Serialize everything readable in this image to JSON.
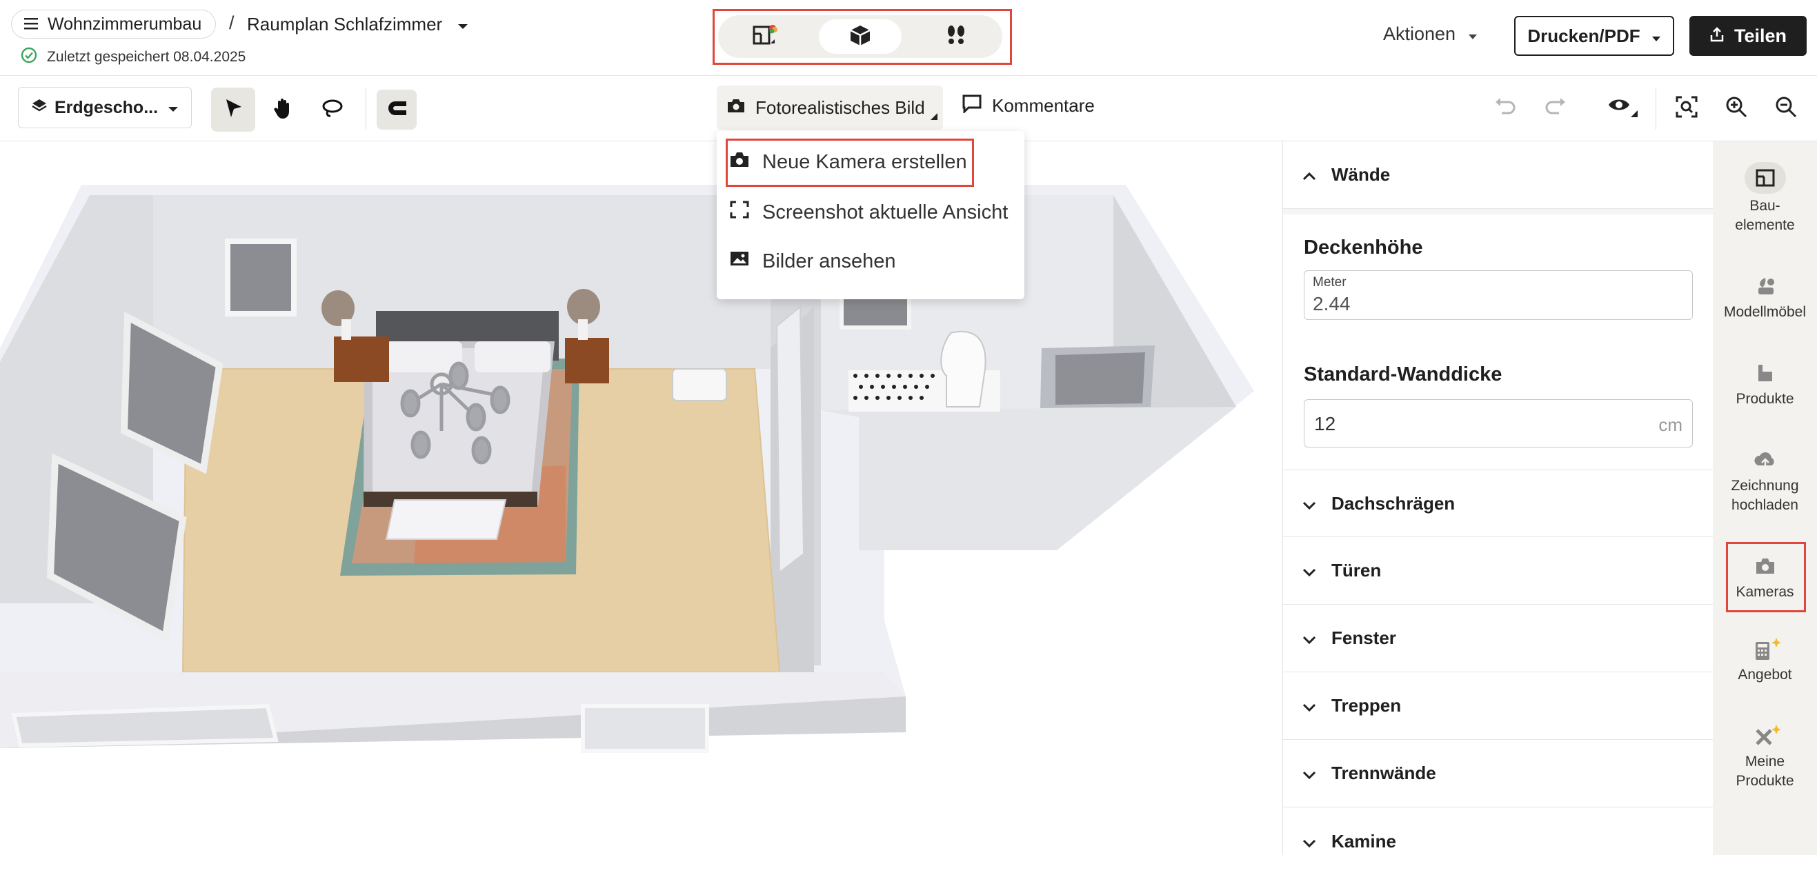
{
  "header": {
    "project_name": "Wohnzimmerumbau",
    "separator": "/",
    "page_name": "Raumplan Schlafzimmer",
    "saved_status": "Zuletzt gespeichert 08.04.2025",
    "view_modes": [
      {
        "name": "2d-plan",
        "active": false
      },
      {
        "name": "3d-view",
        "active": true
      },
      {
        "name": "walkthrough",
        "active": false
      }
    ],
    "actions_label": "Aktionen",
    "print_label": "Drucken/PDF",
    "share_label": "Teilen"
  },
  "toolbar": {
    "floor_label": "Erdgescho...",
    "photo_label": "Fotorealistisches Bild",
    "comments_label": "Kommentare"
  },
  "dropdown": {
    "items": [
      {
        "label": "Neue Kamera erstellen",
        "icon": "camera-icon"
      },
      {
        "label": "Screenshot aktuelle Ansicht",
        "icon": "screenshot-frame-icon"
      },
      {
        "label": "Bilder ansehen",
        "icon": "image-icon"
      }
    ]
  },
  "panel": {
    "walls_section": "Wände",
    "ceiling_label": "Deckenhöhe",
    "ceiling_unit_label": "Meter",
    "ceiling_value": "2.44",
    "wall_thickness_label": "Standard-Wanddicke",
    "wall_thickness_value": "12",
    "wall_thickness_unit": "cm",
    "sections": [
      "Dachschrägen",
      "Türen",
      "Fenster",
      "Treppen",
      "Trennwände",
      "Kamine"
    ]
  },
  "sidebar": {
    "items": [
      {
        "label_line1": "Bau-",
        "label_line2": "elemente",
        "icon": "building-elements-icon"
      },
      {
        "label_line1": "Modellmöbel",
        "label_line2": "",
        "icon": "model-furniture-icon"
      },
      {
        "label_line1": "Produkte",
        "label_line2": "",
        "icon": "products-icon"
      },
      {
        "label_line1": "Zeichnung",
        "label_line2": "hochladen",
        "icon": "upload-icon"
      },
      {
        "label_line1": "Kameras",
        "label_line2": "",
        "icon": "camera-icon"
      },
      {
        "label_line1": "Angebot",
        "label_line2": "",
        "icon": "calculator-icon"
      },
      {
        "label_line1": "Meine",
        "label_line2": "Produkte",
        "icon": "tools-icon"
      }
    ]
  },
  "colors": {
    "highlight": "#e0463b",
    "dark_button": "#1f1f1f",
    "sidebar_bg": "#f4f2ee",
    "saved_green": "#3aa55b"
  }
}
